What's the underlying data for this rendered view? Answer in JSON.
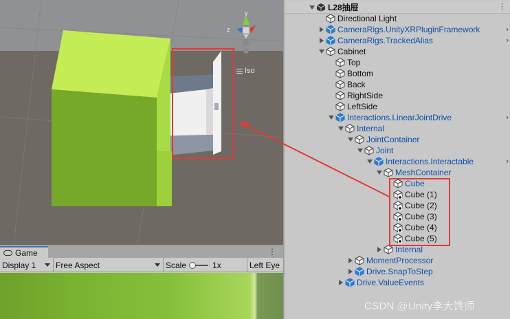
{
  "scene": {
    "view_mode_label": "Iso",
    "gizmo_axes": {
      "y": "y",
      "x": "x",
      "z": "z"
    }
  },
  "game": {
    "tab_label": "Game",
    "kebab": "⋮",
    "display_label": "Display 1",
    "aspect_label": "Free Aspect",
    "scale_label": "Scale",
    "scale_value": "1x",
    "left_eye_label": "Left Eye"
  },
  "hierarchy": {
    "root_label": "L28抽屉",
    "kebab": "⋮",
    "rows": [
      {
        "label": "Directional Light"
      },
      {
        "label": "CameraRigs.UnityXRPluginFramework"
      },
      {
        "label": "CameraRigs.TrackedAlias"
      },
      {
        "label": "Cabinet"
      },
      {
        "label": "Top"
      },
      {
        "label": "Bottom"
      },
      {
        "label": "Back"
      },
      {
        "label": "RightSide"
      },
      {
        "label": "LeftSide"
      },
      {
        "label": "Interactions.LinearJointDrive"
      },
      {
        "label": "Internal"
      },
      {
        "label": "JointContainer"
      },
      {
        "label": "Joint"
      },
      {
        "label": "Interactions.Interactable"
      },
      {
        "label": "MeshContainer"
      },
      {
        "label": "Cube"
      },
      {
        "label": "Cube (1)"
      },
      {
        "label": "Cube (2)"
      },
      {
        "label": "Cube (3)"
      },
      {
        "label": "Cube (4)"
      },
      {
        "label": "Cube (5)"
      },
      {
        "label": "Internal"
      },
      {
        "label": "MomentProcessor"
      },
      {
        "label": "Drive.SnapToStep"
      },
      {
        "label": "Drive.ValueEvents"
      }
    ]
  },
  "watermark": "CSDN @Unity李大馋师",
  "colors": {
    "annotation_red": "#e23a3a",
    "prefab_blue": "#0c4fa8",
    "cube_green": "#b6e24a"
  }
}
